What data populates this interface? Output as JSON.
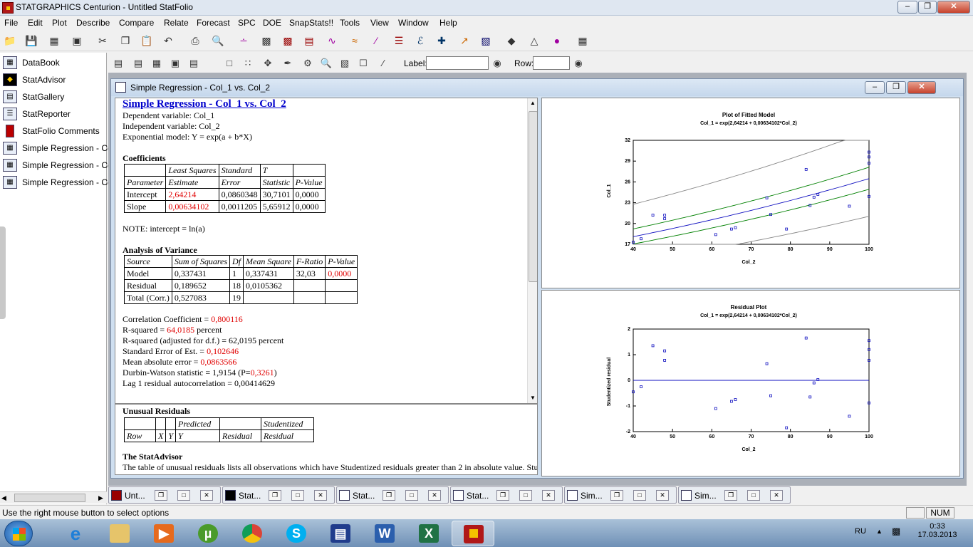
{
  "app": {
    "title": "STATGRAPHICS Centurion - Untitled StatFolio"
  },
  "menu": [
    "File",
    "Edit",
    "Plot",
    "Describe",
    "Compare",
    "Relate",
    "Forecast",
    "SPC",
    "DOE",
    "SnapStats!!",
    "Tools",
    "View",
    "Window",
    "Help"
  ],
  "sidebar": {
    "items": [
      "DataBook",
      "StatAdvisor",
      "StatGallery",
      "StatReporter",
      "StatFolio Comments",
      "Simple Regression - Col_",
      "Simple Regression - Col_",
      "Simple Regression - Col_"
    ]
  },
  "toolbar2": {
    "label_caption": "Label:",
    "row_caption": "Row:"
  },
  "child": {
    "title": "Simple Regression - Col_1 vs. Col_2"
  },
  "report": {
    "heading": "Simple Regression - Col_1 vs. Col_2",
    "dep": "Dependent variable: Col_1",
    "indep": "Independent variable: Col_2",
    "model": "Exponential model: Y = exp(a + b*X)",
    "coef_title": "Coefficients",
    "coef_head1": [
      "",
      "Least Squares",
      "Standard",
      "T",
      ""
    ],
    "coef_head2": [
      "Parameter",
      "Estimate",
      "Error",
      "Statistic",
      "P-Value"
    ],
    "coef_rows": [
      [
        "Intercept",
        "2,64214",
        "0,0860348",
        "30,7101",
        "0,0000"
      ],
      [
        "Slope",
        "0,00634102",
        "0,0011205",
        "5,65912",
        "0,0000"
      ]
    ],
    "note": "NOTE: intercept = ln(a)",
    "anova_title": "Analysis of Variance",
    "anova_head": [
      "Source",
      "Sum of Squares",
      "Df",
      "Mean Square",
      "F-Ratio",
      "P-Value"
    ],
    "anova_rows": [
      [
        "Model",
        "0,337431",
        "1",
        "0,337431",
        "32,03",
        "0,0000"
      ],
      [
        "Residual",
        "0,189652",
        "18",
        "0,0105362",
        "",
        ""
      ],
      [
        "Total (Corr.)",
        "0,527083",
        "19",
        "",
        "",
        ""
      ]
    ],
    "corr_a": "Correlation Coefficient = ",
    "corr_v": "0,800116",
    "rsq_a": "R-squared = ",
    "rsq_v": "64,0185",
    "rsq_b": " percent",
    "rsqadj": "R-squared (adjusted for d.f.) = 62,0195 percent",
    "see_a": "Standard Error of Est. = ",
    "see_v": "0,102646",
    "mae_a": "Mean absolute error = ",
    "mae_v": "0,0863566",
    "dw_a": "Durbin-Watson statistic = 1,9154 (P=",
    "dw_v": "0,3261",
    "dw_b": ")",
    "lag": "Lag 1 residual autocorrelation = 0,00414629"
  },
  "report2": {
    "title": "Unusual Residuals",
    "head1": [
      "",
      "",
      "",
      "Predicted",
      "",
      "Studentized"
    ],
    "head2": [
      "Row",
      "X",
      "Y",
      "Y",
      "Residual",
      "Residual"
    ],
    "advisor_title": "The StatAdvisor",
    "advisor_text": "The table of unusual residuals lists all observations which have Studentized residuals greater than 2 in absolute value.  Stu"
  },
  "chart_data": [
    {
      "type": "scatter",
      "title": "Plot of Fitted Model",
      "subtitle": "Col_1 = exp(2,64214 + 0,00634102*Col_2)",
      "xlabel": "Col_2",
      "ylabel": "Col_1",
      "xlim": [
        40,
        100
      ],
      "ylim": [
        17,
        32
      ],
      "xticks": [
        "40",
        "50",
        "60",
        "70",
        "80",
        "90",
        "100"
      ],
      "yticks": [
        "17",
        "20",
        "23",
        "26",
        "29",
        "32"
      ],
      "points": [
        [
          40,
          17.3
        ],
        [
          42,
          17.8
        ],
        [
          45,
          21.2
        ],
        [
          48,
          21.2
        ],
        [
          48,
          20.7
        ],
        [
          61,
          18.4
        ],
        [
          65,
          19.2
        ],
        [
          66,
          19.4
        ],
        [
          74,
          23.7
        ],
        [
          75,
          21.3
        ],
        [
          79,
          19.2
        ],
        [
          84,
          27.8
        ],
        [
          85,
          22.6
        ],
        [
          86,
          23.8
        ],
        [
          87,
          24.2
        ],
        [
          95,
          22.5
        ],
        [
          100,
          30.3
        ],
        [
          100,
          29.6
        ],
        [
          100,
          28.7
        ],
        [
          100,
          23.9
        ]
      ],
      "fit_a": 2.64214,
      "fit_b": 0.00634102,
      "conf_lim": 0.06,
      "pred_lim": 0.23
    },
    {
      "type": "scatter",
      "title": "Residual Plot",
      "subtitle": "Col_1 = exp(2,64214 + 0,00634102*Col_2)",
      "xlabel": "Col_2",
      "ylabel": "Studentized residual",
      "xlim": [
        40,
        100
      ],
      "ylim": [
        -2,
        2
      ],
      "xticks": [
        "40",
        "50",
        "60",
        "70",
        "80",
        "90",
        "100"
      ],
      "yticks": [
        "-2",
        "-1",
        "0",
        "1",
        "2"
      ],
      "points": [
        [
          40,
          -0.45
        ],
        [
          42,
          -0.25
        ],
        [
          45,
          1.35
        ],
        [
          48,
          1.15
        ],
        [
          48,
          0.78
        ],
        [
          61,
          -1.1
        ],
        [
          65,
          -0.82
        ],
        [
          66,
          -0.75
        ],
        [
          74,
          0.65
        ],
        [
          75,
          -0.6
        ],
        [
          79,
          -1.85
        ],
        [
          84,
          1.65
        ],
        [
          85,
          -0.65
        ],
        [
          86,
          -0.1
        ],
        [
          87,
          0.03
        ],
        [
          95,
          -1.4
        ],
        [
          100,
          1.55
        ],
        [
          100,
          1.2
        ],
        [
          100,
          0.78
        ],
        [
          100,
          -0.88
        ]
      ]
    }
  ],
  "mditabs": [
    {
      "label": "Unt..."
    },
    {
      "label": "Stat..."
    },
    {
      "label": "Stat..."
    },
    {
      "label": "Stat..."
    },
    {
      "label": "Sim..."
    },
    {
      "label": "Sim..."
    }
  ],
  "status": {
    "text": "Use the right mouse button to select options",
    "num": "NUM"
  },
  "tray": {
    "lang": "RU",
    "time": "0:33",
    "date": "17.03.2013"
  }
}
